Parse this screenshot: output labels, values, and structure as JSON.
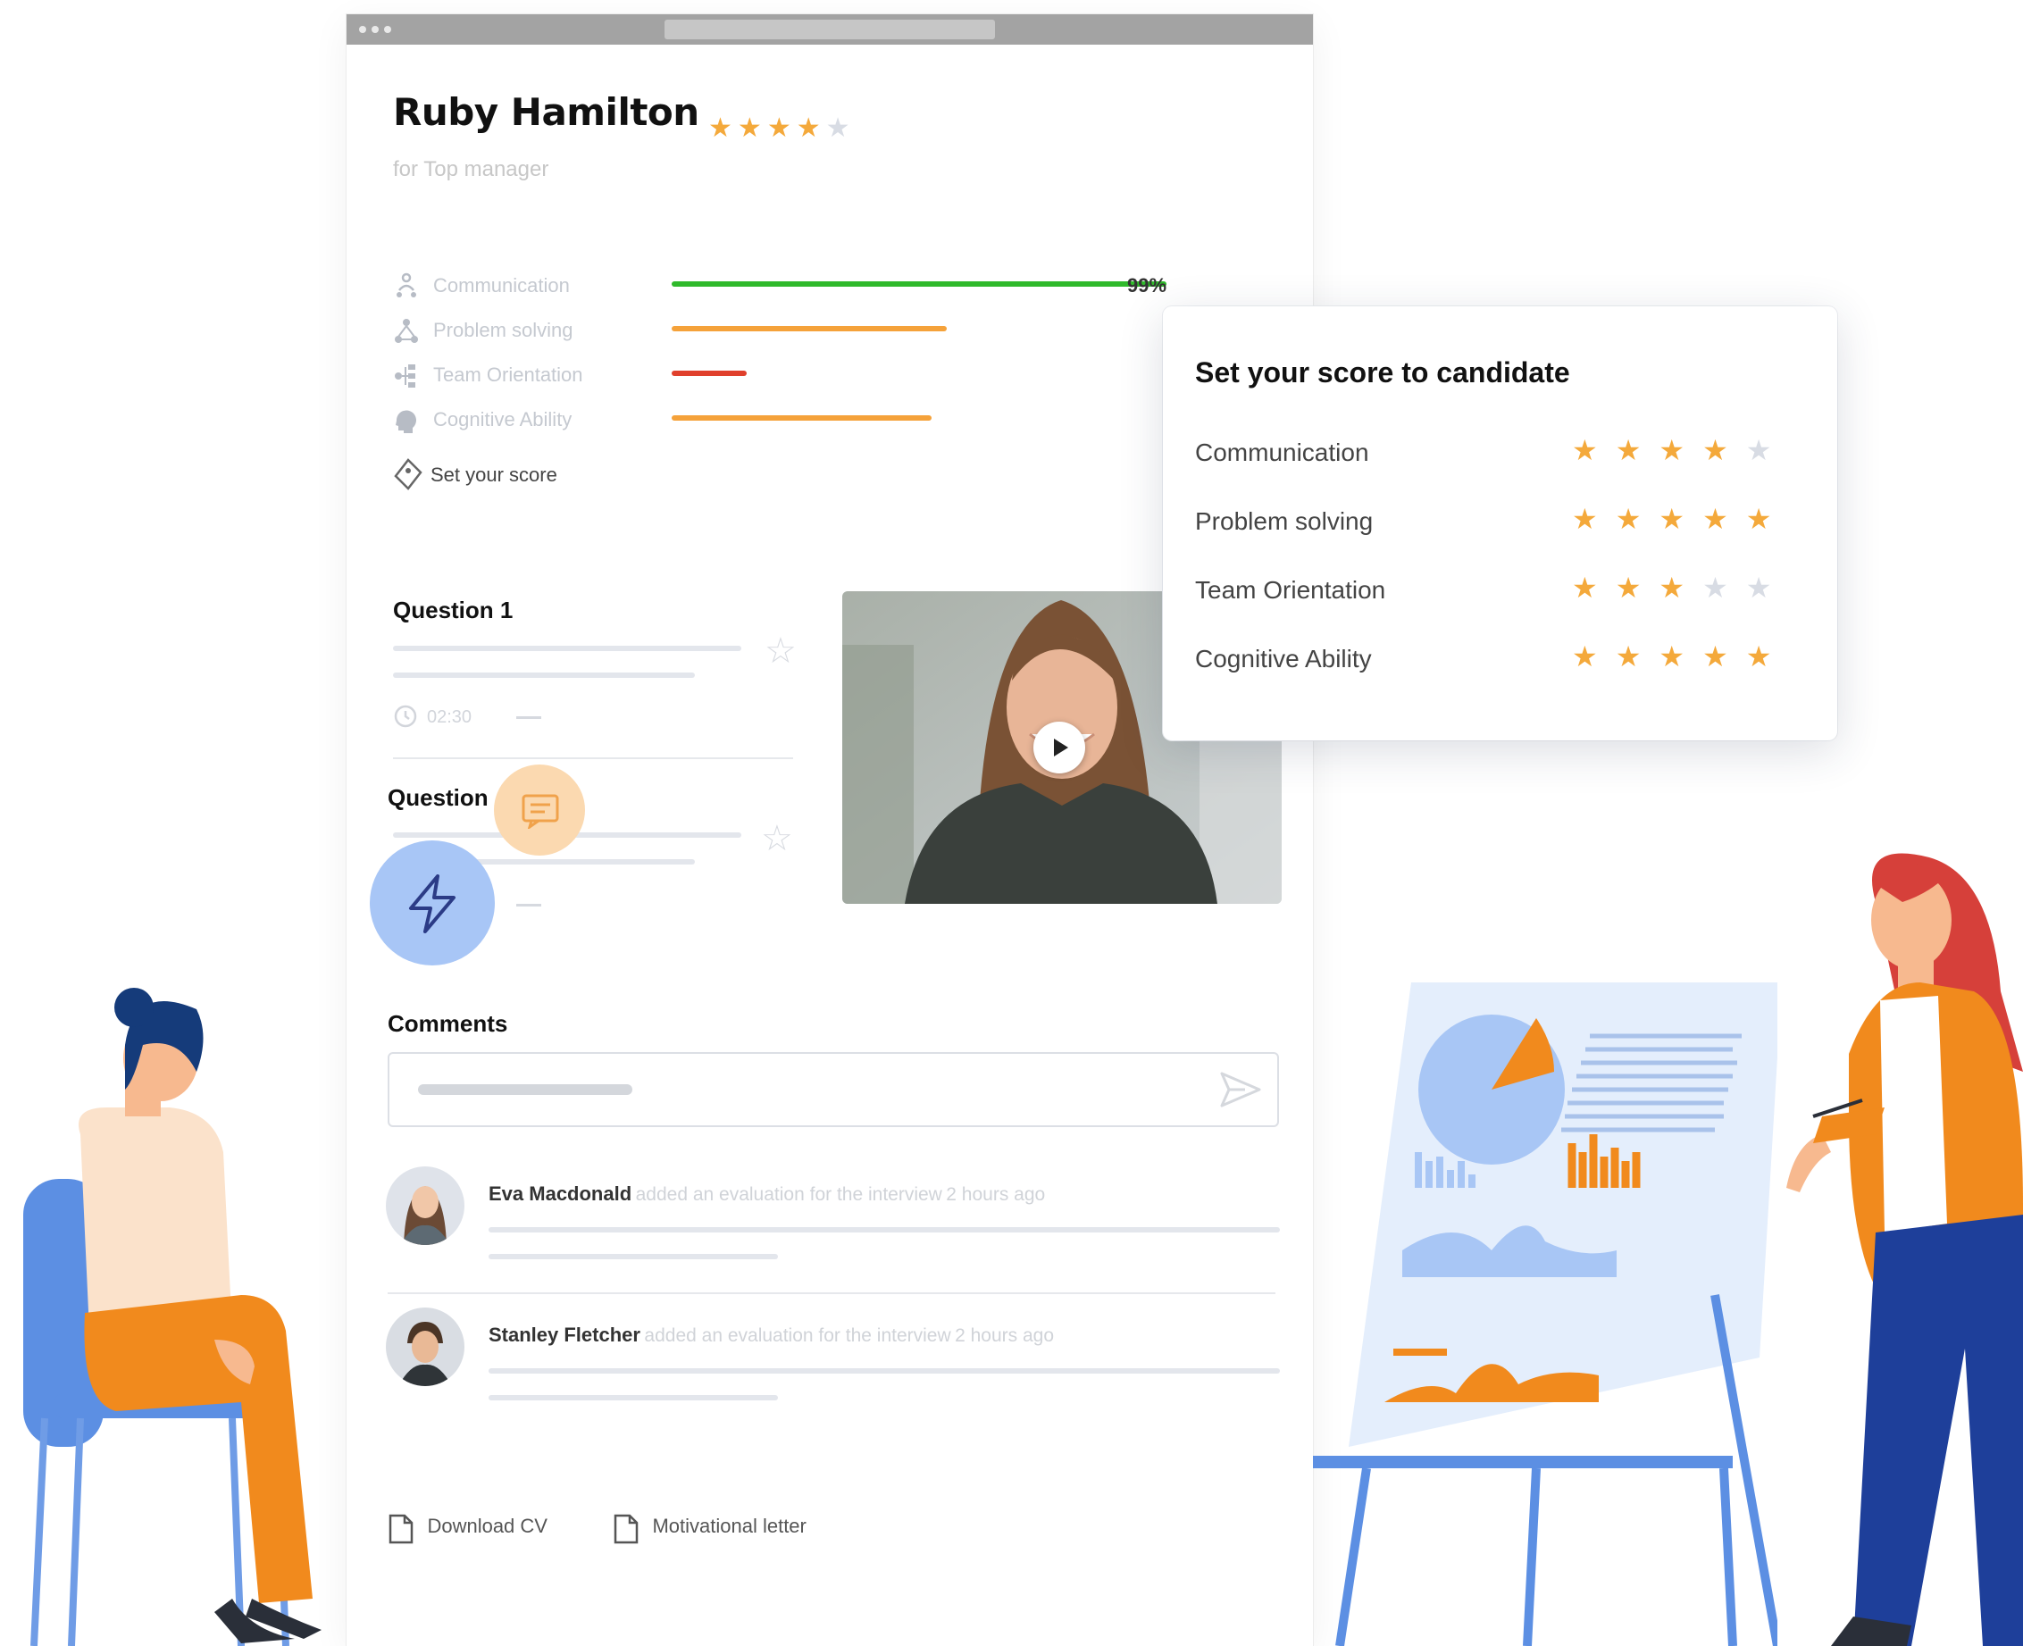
{
  "candidate": {
    "name": "Ruby Hamilton",
    "subtitle": "for Top manager",
    "rating": 4,
    "rating_max": 5
  },
  "skills": [
    {
      "label": "Communication",
      "percent": 99,
      "percent_label": "99%",
      "color": "#2fb92b",
      "icon": "people-icon"
    },
    {
      "label": "Problem solving",
      "percent": 55,
      "color": "#f5a23a",
      "icon": "network-icon"
    },
    {
      "label": "Team Orientation",
      "percent": 15,
      "color": "#e0402c",
      "icon": "hierarchy-icon"
    },
    {
      "label": "Cognitive Ability",
      "percent": 52,
      "color": "#f5a23a",
      "icon": "brain-icon"
    }
  ],
  "set_score_label": "Set your score",
  "questions": [
    {
      "title": "Question 1",
      "time": "02:30"
    },
    {
      "title": "Question"
    }
  ],
  "comments": {
    "title": "Comments",
    "items": [
      {
        "name": "Eva Macdonald",
        "text": "added an evaluation for the interview",
        "time": "2 hours ago"
      },
      {
        "name": "Stanley Fletcher",
        "text": "added an evaluation for the interview",
        "time": "2 hours ago"
      }
    ]
  },
  "documents": [
    {
      "label": "Download CV"
    },
    {
      "label": "Motivational letter"
    }
  ],
  "score_panel": {
    "title": "Set your score to candidate",
    "rows": [
      {
        "label": "Communication",
        "stars": 4
      },
      {
        "label": "Problem solving",
        "stars": 5
      },
      {
        "label": "Team Orientation",
        "stars": 3
      },
      {
        "label": "Cognitive Ability",
        "stars": 5
      }
    ],
    "max": 5
  },
  "colors": {
    "accent_orange": "#f5a23a",
    "accent_blue": "#a9c5f5",
    "navy": "#1e3f9a"
  }
}
